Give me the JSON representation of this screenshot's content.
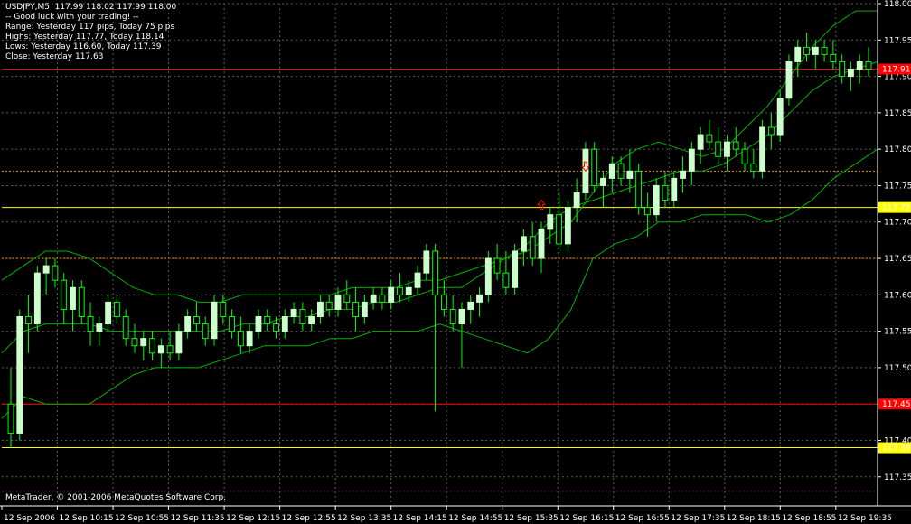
{
  "header": {
    "symbol_line": "USDJPY,M5  117.99 118.02 117.99 118.00",
    "lines": [
      "-- Good luck with your trading! --",
      "Range: Yesterday 117 pips, Today 75 pips",
      "Highs: Yesterday 117.77, Today 118.14",
      "Lows: Yesterday 116.60, Today 117.39",
      "Close: Yesterday 117.63"
    ]
  },
  "footer": {
    "copyright": "MetaTrader, © 2001-2006 MetaQuotes Software Corp."
  },
  "colors": {
    "background": "#000000",
    "grid": "#5a5a5a",
    "bull": "#ccffcc",
    "bear": "#00ff00",
    "band": "#00b000",
    "red_level": "#ff0000",
    "yellow_level": "#ffff00",
    "orange_level": "#ff8c00",
    "purple_level": "#800080",
    "arrow": "#ff0000",
    "text": "#ffffff"
  },
  "chart_data": {
    "type": "candlestick",
    "symbol": "USDJPY",
    "timeframe": "M5",
    "ylim": [
      117.31,
      118.0
    ],
    "price_ticks": [
      "118.00",
      "117.95",
      "117.90",
      "117.85",
      "117.80",
      "117.75",
      "117.70",
      "117.65",
      "117.60",
      "117.55",
      "117.50",
      "117.45",
      "117.40",
      "117.35"
    ],
    "time_labels": [
      "12 Sep 2006",
      "12 Sep 10:15",
      "12 Sep 10:55",
      "12 Sep 11:35",
      "12 Sep 12:15",
      "12 Sep 12:55",
      "12 Sep 13:35",
      "12 Sep 14:15",
      "12 Sep 14:55",
      "12 Sep 15:35",
      "12 Sep 16:15",
      "12 Sep 16:55",
      "12 Sep 17:35",
      "12 Sep 18:15",
      "12 Sep 18:55",
      "12 Sep 19:35"
    ],
    "levels": [
      {
        "price": 117.91,
        "label": "117.91",
        "style": "red_solid"
      },
      {
        "price": 117.72,
        "label": "117.72",
        "style": "yellow_solid"
      },
      {
        "price": 117.45,
        "label": "117.45",
        "style": "red_solid"
      },
      {
        "price": 117.39,
        "label": "117.39",
        "style": "yellow_solid"
      },
      {
        "price": 117.77,
        "label": "",
        "style": "orange_dashed"
      },
      {
        "price": 117.65,
        "label": "",
        "style": "orange_dashed"
      },
      {
        "price": 117.33,
        "label": "",
        "style": "purple_dashed"
      }
    ],
    "candles": [
      [
        117.45,
        117.5,
        117.39,
        117.41
      ],
      [
        117.41,
        117.58,
        117.4,
        117.57
      ],
      [
        117.57,
        117.6,
        117.52,
        117.56
      ],
      [
        117.56,
        117.64,
        117.55,
        117.63
      ],
      [
        117.63,
        117.65,
        117.6,
        117.64
      ],
      [
        117.64,
        117.65,
        117.61,
        117.62
      ],
      [
        117.62,
        117.63,
        117.56,
        117.58
      ],
      [
        117.58,
        117.62,
        117.55,
        117.61
      ],
      [
        117.61,
        117.62,
        117.56,
        117.57
      ],
      [
        117.57,
        117.59,
        117.53,
        117.55
      ],
      [
        117.55,
        117.57,
        117.53,
        117.56
      ],
      [
        117.56,
        117.6,
        117.55,
        117.59
      ],
      [
        117.59,
        117.6,
        117.56,
        117.57
      ],
      [
        117.57,
        117.58,
        117.53,
        117.54
      ],
      [
        117.54,
        117.56,
        117.52,
        117.53
      ],
      [
        117.53,
        117.55,
        117.51,
        117.54
      ],
      [
        117.54,
        117.55,
        117.51,
        117.52
      ],
      [
        117.52,
        117.54,
        117.5,
        117.53
      ],
      [
        117.53,
        117.55,
        117.51,
        117.52
      ],
      [
        117.52,
        117.56,
        117.51,
        117.55
      ],
      [
        117.55,
        117.58,
        117.54,
        117.57
      ],
      [
        117.57,
        117.59,
        117.55,
        117.56
      ],
      [
        117.56,
        117.57,
        117.53,
        117.54
      ],
      [
        117.54,
        117.6,
        117.53,
        117.59
      ],
      [
        117.59,
        117.6,
        117.56,
        117.57
      ],
      [
        117.57,
        117.58,
        117.54,
        117.55
      ],
      [
        117.55,
        117.57,
        117.52,
        117.53
      ],
      [
        117.53,
        117.56,
        117.52,
        117.55
      ],
      [
        117.55,
        117.58,
        117.54,
        117.57
      ],
      [
        117.57,
        117.58,
        117.55,
        117.56
      ],
      [
        117.56,
        117.57,
        117.54,
        117.55
      ],
      [
        117.55,
        117.58,
        117.54,
        117.57
      ],
      [
        117.57,
        117.59,
        117.56,
        117.58
      ],
      [
        117.58,
        117.59,
        117.55,
        117.56
      ],
      [
        117.56,
        117.58,
        117.55,
        117.57
      ],
      [
        117.57,
        117.6,
        117.56,
        117.59
      ],
      [
        117.59,
        117.6,
        117.57,
        117.58
      ],
      [
        117.58,
        117.61,
        117.57,
        117.6
      ],
      [
        117.6,
        117.62,
        117.58,
        117.59
      ],
      [
        117.59,
        117.61,
        117.55,
        117.57
      ],
      [
        117.57,
        117.6,
        117.56,
        117.59
      ],
      [
        117.59,
        117.61,
        117.58,
        117.6
      ],
      [
        117.6,
        117.61,
        117.58,
        117.59
      ],
      [
        117.59,
        117.62,
        117.58,
        117.61
      ],
      [
        117.61,
        117.63,
        117.59,
        117.6
      ],
      [
        117.6,
        117.62,
        117.59,
        117.61
      ],
      [
        117.61,
        117.64,
        117.6,
        117.63
      ],
      [
        117.63,
        117.67,
        117.62,
        117.66
      ],
      [
        117.66,
        117.67,
        117.44,
        117.6
      ],
      [
        117.6,
        117.62,
        117.57,
        117.58
      ],
      [
        117.58,
        117.6,
        117.55,
        117.56
      ],
      [
        117.56,
        117.59,
        117.5,
        117.58
      ],
      [
        117.58,
        117.6,
        117.56,
        117.59
      ],
      [
        117.59,
        117.61,
        117.57,
        117.6
      ],
      [
        117.6,
        117.66,
        117.59,
        117.65
      ],
      [
        117.65,
        117.67,
        117.62,
        117.63
      ],
      [
        117.63,
        117.66,
        117.6,
        117.61
      ],
      [
        117.61,
        117.67,
        117.6,
        117.66
      ],
      [
        117.66,
        117.69,
        117.64,
        117.68
      ],
      [
        117.68,
        117.7,
        117.64,
        117.65
      ],
      [
        117.65,
        117.7,
        117.63,
        117.69
      ],
      [
        117.69,
        117.72,
        117.67,
        117.71
      ],
      [
        117.71,
        117.74,
        117.66,
        117.67
      ],
      [
        117.67,
        117.73,
        117.66,
        117.72
      ],
      [
        117.72,
        117.76,
        117.7,
        117.74
      ],
      [
        117.74,
        117.81,
        117.73,
        117.8
      ],
      [
        117.8,
        117.81,
        117.74,
        117.75
      ],
      [
        117.75,
        117.77,
        117.72,
        117.76
      ],
      [
        117.76,
        117.79,
        117.74,
        117.78
      ],
      [
        117.78,
        117.79,
        117.75,
        117.76
      ],
      [
        117.76,
        117.8,
        117.74,
        117.77
      ],
      [
        117.77,
        117.78,
        117.71,
        117.72
      ],
      [
        117.72,
        117.74,
        117.68,
        117.71
      ],
      [
        117.71,
        117.76,
        117.7,
        117.75
      ],
      [
        117.75,
        117.77,
        117.72,
        117.73
      ],
      [
        117.73,
        117.77,
        117.72,
        117.76
      ],
      [
        117.76,
        117.79,
        117.74,
        117.77
      ],
      [
        117.77,
        117.81,
        117.75,
        117.8
      ],
      [
        117.8,
        117.83,
        117.78,
        117.82
      ],
      [
        117.82,
        117.84,
        117.8,
        117.81
      ],
      [
        117.81,
        117.83,
        117.78,
        117.79
      ],
      [
        117.79,
        117.82,
        117.77,
        117.81
      ],
      [
        117.81,
        117.83,
        117.79,
        117.8
      ],
      [
        117.8,
        117.81,
        117.77,
        117.78
      ],
      [
        117.78,
        117.8,
        117.76,
        117.77
      ],
      [
        117.77,
        117.84,
        117.76,
        117.83
      ],
      [
        117.83,
        117.85,
        117.8,
        117.82
      ],
      [
        117.82,
        117.88,
        117.81,
        117.87
      ],
      [
        117.87,
        117.93,
        117.86,
        117.92
      ],
      [
        117.92,
        117.95,
        117.9,
        117.94
      ],
      [
        117.94,
        117.96,
        117.92,
        117.93
      ],
      [
        117.93,
        117.95,
        117.91,
        117.94
      ],
      [
        117.94,
        117.95,
        117.92,
        117.93
      ],
      [
        117.93,
        117.95,
        117.91,
        117.92
      ],
      [
        117.92,
        117.93,
        117.89,
        117.9
      ],
      [
        117.9,
        117.92,
        117.88,
        117.91
      ],
      [
        117.91,
        117.93,
        117.89,
        117.92
      ],
      [
        117.92,
        117.94,
        117.9,
        117.91
      ]
    ],
    "bollinger": {
      "upper": [
        117.62,
        117.64,
        117.66,
        117.66,
        117.65,
        117.63,
        117.61,
        117.6,
        117.6,
        117.59,
        117.59,
        117.6,
        117.6,
        117.6,
        117.6,
        117.6,
        117.61,
        117.61,
        117.61,
        117.62,
        117.62,
        117.63,
        117.64,
        117.65,
        117.66,
        117.68,
        117.7,
        117.74,
        117.78,
        117.8,
        117.81,
        117.8,
        117.79,
        117.8,
        117.83,
        117.86,
        117.9,
        117.94,
        117.97,
        117.99,
        117.99
      ],
      "middle": [
        117.52,
        117.55,
        117.56,
        117.56,
        117.56,
        117.55,
        117.55,
        117.55,
        117.55,
        117.55,
        117.55,
        117.56,
        117.56,
        117.57,
        117.57,
        117.58,
        117.58,
        117.59,
        117.59,
        117.6,
        117.61,
        117.61,
        117.63,
        117.65,
        117.67,
        117.7,
        117.72,
        117.73,
        117.74,
        117.75,
        117.76,
        117.77,
        117.77,
        117.78,
        117.8,
        117.82,
        117.85,
        117.88,
        117.9,
        117.91,
        117.92
      ],
      "lower": [
        117.43,
        117.46,
        117.45,
        117.45,
        117.45,
        117.47,
        117.49,
        117.5,
        117.5,
        117.5,
        117.51,
        117.52,
        117.53,
        117.53,
        117.53,
        117.54,
        117.54,
        117.55,
        117.55,
        117.55,
        117.56,
        117.55,
        117.54,
        117.53,
        117.52,
        117.54,
        117.58,
        117.65,
        117.67,
        117.68,
        117.7,
        117.7,
        117.71,
        117.71,
        117.71,
        117.7,
        117.71,
        117.73,
        117.76,
        117.78,
        117.8
      ]
    },
    "signals": [
      {
        "type": "buy",
        "candle": 60,
        "price": 117.72
      },
      {
        "type": "sell",
        "candle": 65,
        "price": 117.78
      }
    ]
  }
}
